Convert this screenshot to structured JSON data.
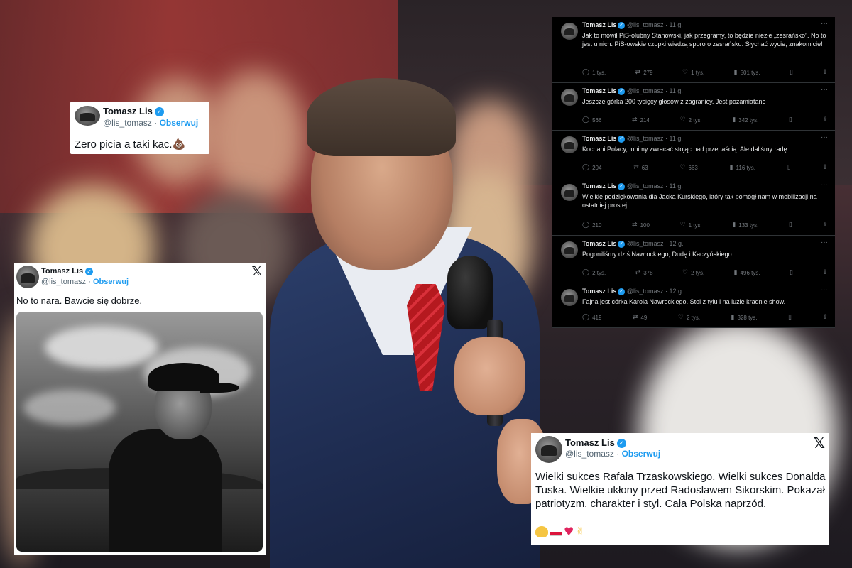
{
  "tweet1": {
    "name": "Tomasz Lis",
    "handle": "@lis_tomasz",
    "follow": "Obserwuj",
    "text": "Zero picia a taki kac.",
    "emoji": "💩"
  },
  "tweet2": {
    "name": "Tomasz Lis",
    "handle": "@lis_tomasz",
    "follow": "Obserwuj",
    "text": "No to nara. Bawcie się dobrze.",
    "x_logo": "𝕏"
  },
  "thread": {
    "items": [
      {
        "name": "Tomasz Lis",
        "handle": "@lis_tomasz · 11 g.",
        "text": "Jak to mówił PiS-olubny Stanowski, jak przegramy, to będzie niezłe „zesrańsko”. No to jest u nich. PiS-owskie czopki wiedzą sporo o zesrańsku. Słychać wycie, znakomicie!",
        "replies": "1 tys.",
        "reposts": "279",
        "likes": "1 tys.",
        "views": "501 tys."
      },
      {
        "name": "Tomasz Lis",
        "handle": "@lis_tomasz · 11 g.",
        "text": "Jeszcze górka 200 tysięcy głosów z zagranicy. Jest pozamiatane",
        "replies": "566",
        "reposts": "214",
        "likes": "2 tys.",
        "views": "342 tys."
      },
      {
        "name": "Tomasz Lis",
        "handle": "@lis_tomasz · 11 g.",
        "text": "Kochani Polacy, lubimy zwracać stojąc nad przepaścią. Ale daliśmy radę",
        "replies": "204",
        "reposts": "63",
        "likes": "663",
        "views": "116 tys."
      },
      {
        "name": "Tomasz Lis",
        "handle": "@lis_tomasz · 11 g.",
        "text": "Wielkie podziękowania dla Jacka Kurskiego, który tak pomógł nam w mobilizacji na ostatniej prostej.",
        "replies": "210",
        "reposts": "100",
        "likes": "1 tys.",
        "views": "133 tys."
      },
      {
        "name": "Tomasz Lis",
        "handle": "@lis_tomasz · 12 g.",
        "text": "Pogoniliśmy dziś Nawrockiego, Dudę i Kaczyńskiego.",
        "replies": "2 tys.",
        "reposts": "378",
        "likes": "2 tys.",
        "views": "496 tys."
      },
      {
        "name": "Tomasz Lis",
        "handle": "@lis_tomasz · 12 g.",
        "text": "Fajna jest córka Karola Nawrockiego. Stoi z tyłu i na luzie kradnie show.",
        "replies": "419",
        "reposts": "49",
        "likes": "2 tys.",
        "views": "328 tys."
      }
    ]
  },
  "tweet4": {
    "name": "Tomasz Lis",
    "handle": "@lis_tomasz",
    "follow": "Obserwuj",
    "text": "Wielki sukces Rafała Trzaskowskiego. Wielki sukces Donalda Tuska. Wielkie ukłony przed Radoslawem Sikorskim. Pokazał patriotyzm, charakter i styl. Cała Polska naprzód.",
    "x_logo": "𝕏"
  },
  "icons": {
    "verified": "✓",
    "more": "···",
    "reply": "◯",
    "repost": "⇄",
    "like": "♡",
    "views": "▮",
    "bookmark": "▯",
    "share": "⇪"
  },
  "colors": {
    "accent": "#1d9bf0",
    "dark_bg": "#000000",
    "muted": "#71767b"
  }
}
